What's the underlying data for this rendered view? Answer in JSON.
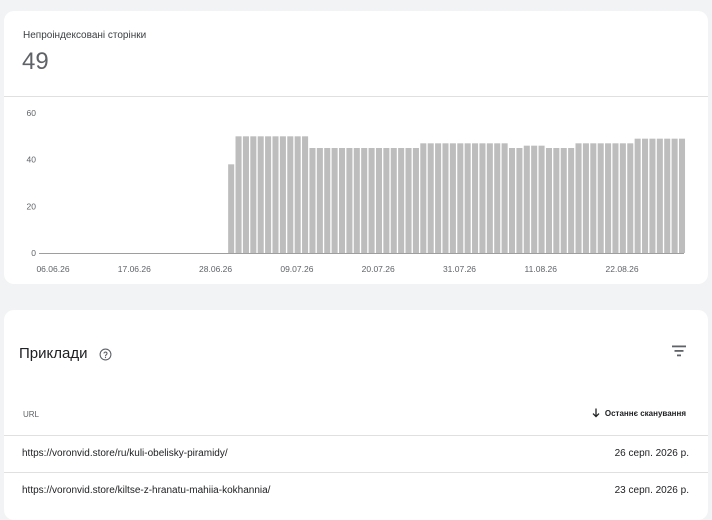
{
  "stats": {
    "label": "Непроіндексовані сторінки",
    "value": "49"
  },
  "chart_data": {
    "type": "bar",
    "ylim": [
      0,
      60
    ],
    "y_ticks": [
      "0",
      "20",
      "40",
      "60"
    ],
    "x_tick_labels": [
      "06.06.26",
      "17.06.26",
      "28.06.26",
      "09.07.26",
      "20.07.26",
      "31.07.26",
      "11.08.26",
      "22.08.26"
    ],
    "start_date": "06.06.26",
    "values": [
      0,
      0,
      0,
      0,
      0,
      0,
      0,
      0,
      0,
      0,
      0,
      0,
      0,
      0,
      0,
      0,
      0,
      0,
      0,
      0,
      0,
      0,
      0,
      0,
      0,
      0,
      38,
      50,
      50,
      50,
      50,
      50,
      50,
      50,
      50,
      50,
      50,
      45,
      45,
      45,
      45,
      45,
      45,
      45,
      45,
      45,
      45,
      45,
      45,
      45,
      45,
      45,
      47,
      47,
      47,
      47,
      47,
      47,
      47,
      47,
      47,
      47,
      47,
      47,
      45,
      45,
      46,
      46,
      46,
      45,
      45,
      45,
      45,
      47,
      47,
      47,
      47,
      47,
      47,
      47,
      47,
      49,
      49,
      49,
      49,
      49,
      49,
      49
    ],
    "bar_color": "#bdbdbd",
    "grid": false
  },
  "examples": {
    "title": "Приклади",
    "columns": {
      "url": "URL",
      "last_crawl": "Останнє сканування"
    },
    "rows": [
      {
        "url": "https://voronvid.store/ru/kuli-obelisky-piramidy/",
        "date": "26 серп. 2026 р."
      },
      {
        "url": "https://voronvid.store/kiltse-z-hranatu-mahiia-kokhannia/",
        "date": "23 серп. 2026 р."
      }
    ]
  },
  "icons": {
    "help": "help-circle-icon",
    "filter": "filter-icon",
    "sort": "arrow-down-icon"
  }
}
